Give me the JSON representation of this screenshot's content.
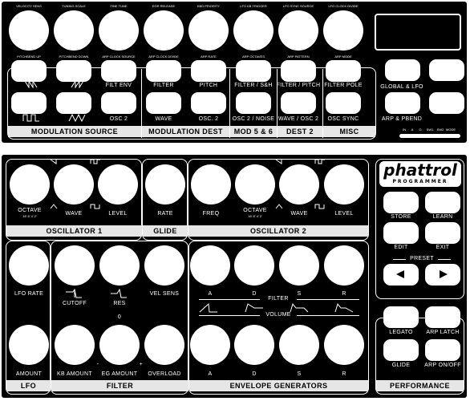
{
  "top": {
    "knob_labels": [
      "VELOCITY SENS",
      "TUNING SCALE",
      "FINE TUNE",
      "EGR RELEASE",
      "KBD PRIORITY",
      "LFO KB TRIGGER",
      "LFO SYNC SOURCE",
      "LFO CLOCK DIVIDE"
    ],
    "upper_button_labels": [
      "PITCHBEND UP",
      "PITCHBEND DOWN",
      "ARP CLOCK SOURCE",
      "ARP CLOCK DIVIDE",
      "ARP RATE",
      "ARP OCTAVES",
      "ARP PATTERN",
      "ARP MODE"
    ],
    "mid_labels": [
      "FILT ENV",
      "FILTER",
      "PITCH",
      "FILTER / S&H",
      "FILTER / PITCH",
      "FILTER POLE"
    ],
    "low_labels": [
      "OSC 2",
      "WAVE",
      "OSC. 2",
      "OSC 2 / NOISE",
      "WAVE / OSC 2",
      "OSC SYNC"
    ],
    "sections": [
      "MODULATION SOURCE",
      "MODULATION DEST",
      "MOD 5 & 6",
      "DEST 2",
      "MISC"
    ],
    "right_buttons": [
      "GLOBAL & LFO",
      "ARP & PBEND"
    ],
    "scale_labels": [
      "IN",
      "A",
      "G",
      "SW1",
      "SW2",
      "MODE"
    ]
  },
  "bottom": {
    "osc1": {
      "labels": [
        "OCTAVE",
        "WAVE",
        "LEVEL"
      ],
      "octave_scale": "16' 8' 4' 2'",
      "section": "OSCILLATOR 1"
    },
    "glide": {
      "label": "RATE",
      "section": "GLIDE"
    },
    "osc2": {
      "labels": [
        "FREQ",
        "OCTAVE",
        "WAVE",
        "LEVEL"
      ],
      "octave_scale": "16' 8' 4' 2'",
      "section": "OSCILLATOR 2"
    },
    "lfo": {
      "labels": [
        "LFO RATE",
        "AMOUNT"
      ],
      "section": "LFO"
    },
    "filter": {
      "labels": [
        "CUTOFF",
        "RES",
        "VEL SENS",
        "KB AMOUNT",
        "EG AMOUNT",
        "OVERLOAD"
      ],
      "eg_zero": "0",
      "eg_minus": "-",
      "eg_plus": "+",
      "section": "FILTER"
    },
    "env": {
      "labels": [
        "A",
        "D",
        "S",
        "R"
      ],
      "filter_label": "FILTER",
      "volume_label": "VOLUME",
      "bottom_labels": [
        "A",
        "D",
        "S",
        "R"
      ],
      "section": "ENVELOPE GENERATORS"
    },
    "brand": {
      "logo": "phattrol",
      "sub": "PROGRAMMER"
    },
    "programmer_buttons": [
      "STORE",
      "LEARN",
      "EDIT",
      "EXIT"
    ],
    "preset_label": "PRESET",
    "performance_buttons": [
      "LEGATO",
      "ARP LATCH",
      "GLIDE",
      "ARP ON/OFF"
    ],
    "performance_section": "PERFORMANCE"
  }
}
